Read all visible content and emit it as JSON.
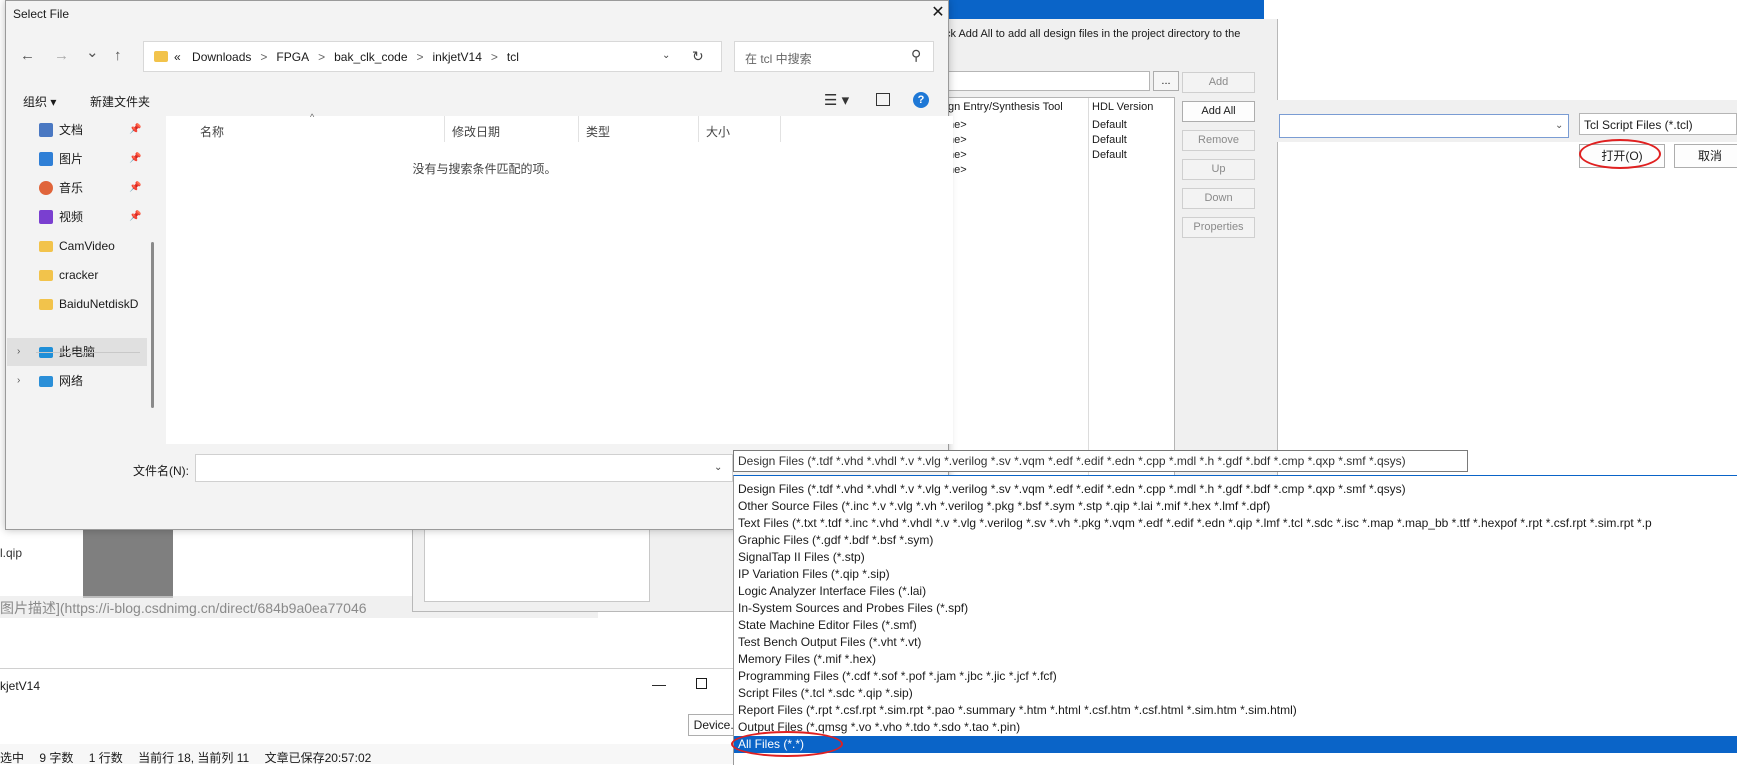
{
  "dialog": {
    "title": "Select File",
    "close_glyph": "✕",
    "nav": {
      "back": "←",
      "forward": "→",
      "history": "⌄",
      "up": "↑"
    },
    "address": {
      "overflow": "«",
      "crumbs": [
        "Downloads",
        "FPGA",
        "bak_clk_code",
        "inkjetV14",
        "tcl"
      ],
      "separator": ">"
    },
    "search": {
      "placeholder": "在 tcl 中搜索"
    },
    "commandbar": {
      "organize": "组织 ▾",
      "new_folder": "新建文件夹"
    },
    "nav_pane": {
      "items": [
        {
          "label": "文档",
          "icon": "documents-icon",
          "color": "#4a78c2",
          "pinned": true
        },
        {
          "label": "图片",
          "icon": "pictures-icon",
          "color": "#2f7fd6",
          "pinned": true
        },
        {
          "label": "音乐",
          "icon": "music-icon",
          "color": "#e0643a",
          "pinned": true
        },
        {
          "label": "视频",
          "icon": "videos-icon",
          "color": "#7a3fd0",
          "pinned": true
        },
        {
          "label": "CamVideo",
          "icon": "folder-icon",
          "color": "#f2c34b",
          "pinned": false
        },
        {
          "label": "cracker",
          "icon": "folder-icon",
          "color": "#f2c34b",
          "pinned": false
        },
        {
          "label": "BaiduNetdiskD",
          "icon": "folder-icon",
          "color": "#f2c34b",
          "pinned": false
        }
      ],
      "this_pc": "此电脑",
      "network": "网络"
    },
    "columns": [
      "名称",
      "修改日期",
      "类型",
      "大小"
    ],
    "empty_message": "没有与搜索条件匹配的项。",
    "filename_label": "文件名(N):",
    "filename_value": ""
  },
  "filetype_dropdown": {
    "current": "Design Files (*.tdf *.vhd *.vhdl *.v *.vlg *.verilog *.sv *.vqm *.edf *.edif *.edn *.cpp *.mdl *.h *.gdf *.bdf *.cmp *.qxp *.smf *.qsys)",
    "options": [
      "Design Files (*.tdf *.vhd *.vhdl *.v *.vlg *.verilog *.sv *.vqm *.edf *.edif *.edn *.cpp *.mdl *.h *.gdf *.bdf *.cmp *.qxp *.smf *.qsys)",
      "Other Source Files (*.inc *.v *.vlg *.vh *.verilog *.pkg *.bsf *.sym *.stp *.qip *.lai *.mif *.hex *.lmf *.dpf)",
      "Text Files (*.txt *.tdf *.inc *.vhd *.vhdl *.v *.vlg *.verilog *.sv *.vh *.pkg *.vqm *.edf *.edif *.edn *.qip *.lmf *.tcl *.sdc *.isc *.map *.map_bb *.ttf *.hexpof *.rpt *.csf.rpt *.sim.rpt *.p",
      "Graphic Files (*.gdf *.bdf *.bsf *.sym)",
      "SignalTap II Files (*.stp)",
      "IP Variation Files (*.qip *.sip)",
      "Logic Analyzer Interface Files (*.lai)",
      "In-System Sources and Probes Files (*.spf)",
      "State Machine Editor Files (*.smf)",
      "Test Bench Output Files (*.vht *.vt)",
      "Memory Files (*.mif *.hex)",
      "Programming Files (*.cdf *.sof *.pof *.jam *.jbc *.jic *.jcf *.fcf)",
      "Script Files (*.tcl *.sdc *.qip *.sip)",
      "Report Files (*.rpt *.csf.rpt *.sim.rpt *.pao *.summary *.htm *.html *.csf.htm *.csf.html *.sim.htm *.sim.html)",
      "Output Files (*.qmsg *.vo *.vho *.tdo *.sdo *.tao *.pin)",
      "All Files (*.*)"
    ],
    "selected_index": 15
  },
  "background_wizard": {
    "instruction": "ck Add All to add all design files in the project directory to the",
    "browse": "...",
    "table_headers": [
      "gn Entry/Synthesis Tool",
      "HDL Version"
    ],
    "table_rows": [
      {
        "tool": "ne>",
        "hdl": "Default"
      },
      {
        "tool": "ne>",
        "hdl": "Default"
      },
      {
        "tool": "ne>",
        "hdl": "Default"
      },
      {
        "tool": "ne>",
        "hdl": ""
      }
    ],
    "buttons": [
      {
        "label": "Add",
        "enabled": false
      },
      {
        "label": "Add All",
        "enabled": true
      },
      {
        "label": "Remove",
        "enabled": false
      },
      {
        "label": "Up",
        "enabled": false
      },
      {
        "label": "Down",
        "enabled": false
      },
      {
        "label": "Properties",
        "enabled": false
      }
    ]
  },
  "background_right": {
    "filter": "Tcl Script Files (*.tcl)",
    "open_button": "打开(O)",
    "cancel_button": "取消"
  },
  "background_editor": {
    "qip_text": "l.qip",
    "link_text": "图片描述](https://i-blog.csdnimg.cn/direct/684b9a0ea77046",
    "window_title": "kjetV14",
    "minimize": "—",
    "device_button": "Device...",
    "status": [
      "选中",
      "9 字数",
      "1 行数",
      "当前行 18, 当前列 11",
      "文章已保存20:57:02"
    ]
  },
  "colors": {
    "accent": "#0a64c8",
    "highlight": "#e02020"
  }
}
